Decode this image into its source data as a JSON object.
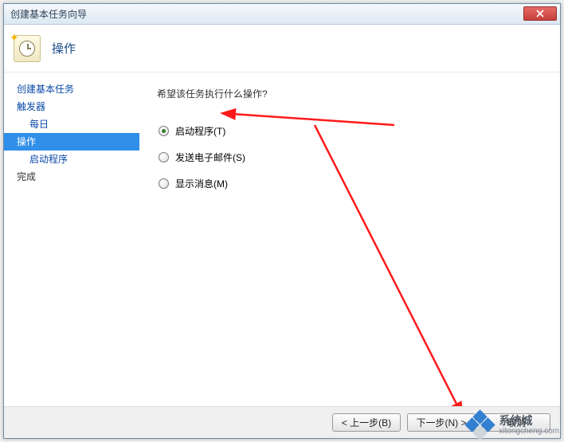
{
  "window": {
    "title": "创建基本任务向导"
  },
  "header": {
    "title": "操作"
  },
  "sidebar": {
    "items": [
      {
        "label": "创建基本任务",
        "sub": false,
        "selected": false,
        "link": true
      },
      {
        "label": "触发器",
        "sub": false,
        "selected": false,
        "link": true
      },
      {
        "label": "每日",
        "sub": true,
        "selected": false,
        "link": true
      },
      {
        "label": "操作",
        "sub": false,
        "selected": true,
        "link": true
      },
      {
        "label": "启动程序",
        "sub": true,
        "selected": false,
        "link": true
      },
      {
        "label": "完成",
        "sub": false,
        "selected": false,
        "link": false
      }
    ]
  },
  "content": {
    "prompt": "希望该任务执行什么操作?",
    "options": [
      {
        "label": "启动程序(T)",
        "checked": true
      },
      {
        "label": "发送电子邮件(S)",
        "checked": false
      },
      {
        "label": "显示消息(M)",
        "checked": false
      }
    ]
  },
  "footer": {
    "back": "< 上一步(B)",
    "next": "下一步(N) >",
    "cancel": "取消"
  },
  "watermark": {
    "brand": "系统城",
    "url": "xitongcheng.com"
  }
}
